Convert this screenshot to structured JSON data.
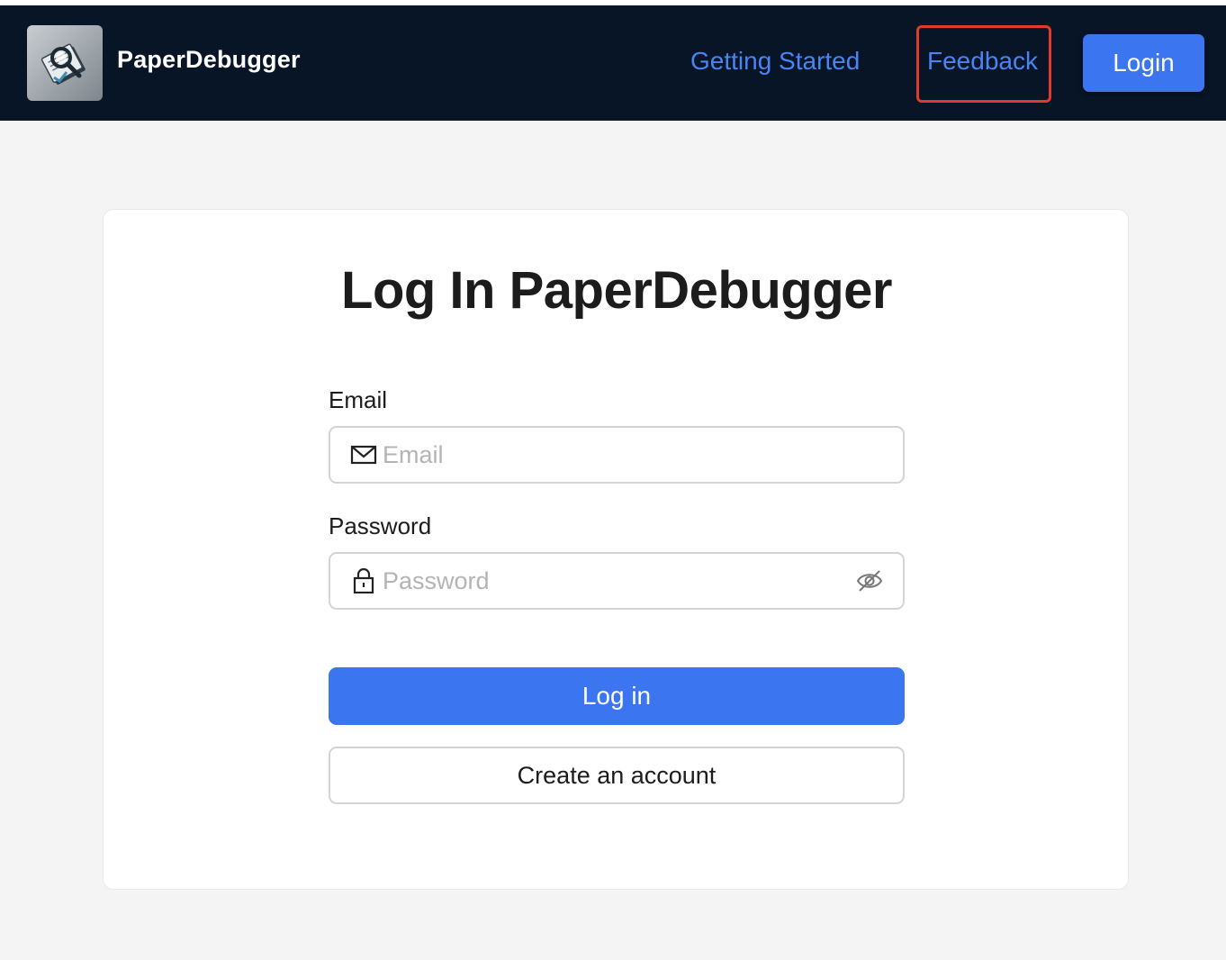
{
  "header": {
    "brand": "PaperDebugger",
    "logo_icon": "paper-magnifier-logo-icon",
    "nav_links": [
      "Getting Started",
      "Feedback"
    ],
    "login_button": "Login",
    "link_color": "#4a84f2",
    "background_color": "#071527",
    "highlight_color": "#e23a2c"
  },
  "login_form": {
    "title": "Log In PaperDebugger",
    "email": {
      "label": "Email",
      "placeholder": "Email",
      "value": "",
      "icon": "mail-icon"
    },
    "password": {
      "label": "Password",
      "placeholder": "Password",
      "value": "",
      "icon": "lock-icon",
      "toggle_icon": "eye-off-icon"
    },
    "submit_button": "Log in",
    "create_account_button": "Create an account",
    "accent_color": "#3b76f0"
  }
}
